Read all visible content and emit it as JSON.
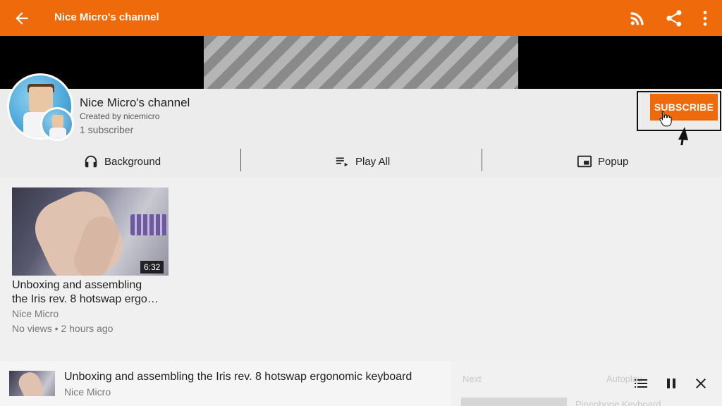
{
  "appbar": {
    "title": "Nice Micro's channel",
    "back_icon": "arrow-left-icon",
    "rss_icon": "rss-icon",
    "share_icon": "share-icon",
    "menu_icon": "more-vert-icon",
    "color": "#ee6a0a"
  },
  "channel": {
    "name": "Nice Micro's channel",
    "created_by": "Created by nicemicro",
    "subscribers": "1 subscriber",
    "subscribe_label": "SUBSCRIBE"
  },
  "actions": [
    {
      "label": "Background",
      "icon": "headphones-icon"
    },
    {
      "label": "Play All",
      "icon": "playlist-play-icon"
    },
    {
      "label": "Popup",
      "icon": "picture-in-picture-icon"
    }
  ],
  "videos": [
    {
      "title_line1": "Unboxing and assembling",
      "title_line2": "the Iris rev. 8 hotswap ergo…",
      "uploader": "Nice Micro",
      "meta": "No views • 2 hours ago",
      "duration": "6:32"
    }
  ],
  "player": {
    "title": "Unboxing and assembling the Iris rev. 8 hotswap ergonomic keyboard",
    "uploader": "Nice Micro",
    "queue_icon": "queue-list-icon",
    "pause_icon": "pause-icon",
    "close_icon": "close-icon",
    "ghost_next": "Next",
    "ghost_autoplay": "Autoplay",
    "ghost_item": "Pinephone Keyboard"
  }
}
